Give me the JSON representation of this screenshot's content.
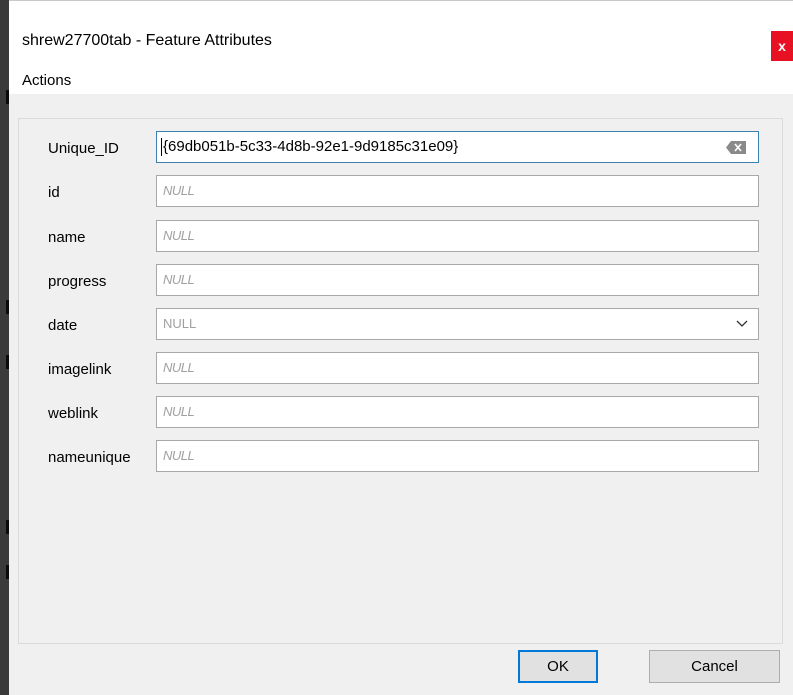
{
  "window": {
    "title": "shrew27700tab - Feature Attributes",
    "close_glyph": "x"
  },
  "menu": {
    "items": [
      "Actions"
    ]
  },
  "form": {
    "fields": [
      {
        "label": "Unique_ID",
        "value": "{69db051b-5c33-4d8b-92e1-9d9185c31e09}",
        "type": "text"
      },
      {
        "label": "id",
        "value": "NULL",
        "type": "text"
      },
      {
        "label": "name",
        "value": "NULL",
        "type": "text"
      },
      {
        "label": "progress",
        "value": "NULL",
        "type": "text"
      },
      {
        "label": "date",
        "value": "NULL",
        "type": "select"
      },
      {
        "label": "imagelink",
        "value": "NULL",
        "type": "text"
      },
      {
        "label": "weblink",
        "value": "NULL",
        "type": "text"
      },
      {
        "label": "nameunique",
        "value": "NULL",
        "type": "text"
      }
    ]
  },
  "buttons": {
    "ok_label": "OK",
    "cancel_label": "Cancel"
  },
  "colors": {
    "close_button": "#e81123",
    "focus_border": "#3c7fb1",
    "default_button_border": "#0078d7",
    "null_text": "#a0a0a0"
  }
}
